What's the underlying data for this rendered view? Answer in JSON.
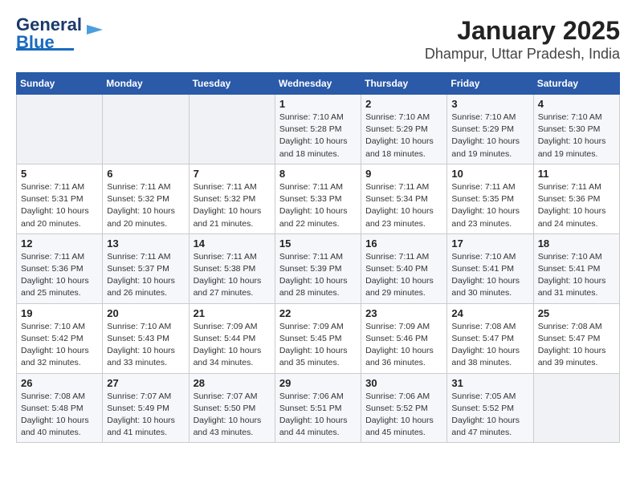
{
  "logo": {
    "line1": "General",
    "line2": "Blue"
  },
  "title": "January 2025",
  "subtitle": "Dhampur, Uttar Pradesh, India",
  "days_header": [
    "Sunday",
    "Monday",
    "Tuesday",
    "Wednesday",
    "Thursday",
    "Friday",
    "Saturday"
  ],
  "weeks": [
    [
      {
        "day": "",
        "info": ""
      },
      {
        "day": "",
        "info": ""
      },
      {
        "day": "",
        "info": ""
      },
      {
        "day": "1",
        "info": "Sunrise: 7:10 AM\nSunset: 5:28 PM\nDaylight: 10 hours\nand 18 minutes."
      },
      {
        "day": "2",
        "info": "Sunrise: 7:10 AM\nSunset: 5:29 PM\nDaylight: 10 hours\nand 18 minutes."
      },
      {
        "day": "3",
        "info": "Sunrise: 7:10 AM\nSunset: 5:29 PM\nDaylight: 10 hours\nand 19 minutes."
      },
      {
        "day": "4",
        "info": "Sunrise: 7:10 AM\nSunset: 5:30 PM\nDaylight: 10 hours\nand 19 minutes."
      }
    ],
    [
      {
        "day": "5",
        "info": "Sunrise: 7:11 AM\nSunset: 5:31 PM\nDaylight: 10 hours\nand 20 minutes."
      },
      {
        "day": "6",
        "info": "Sunrise: 7:11 AM\nSunset: 5:32 PM\nDaylight: 10 hours\nand 20 minutes."
      },
      {
        "day": "7",
        "info": "Sunrise: 7:11 AM\nSunset: 5:32 PM\nDaylight: 10 hours\nand 21 minutes."
      },
      {
        "day": "8",
        "info": "Sunrise: 7:11 AM\nSunset: 5:33 PM\nDaylight: 10 hours\nand 22 minutes."
      },
      {
        "day": "9",
        "info": "Sunrise: 7:11 AM\nSunset: 5:34 PM\nDaylight: 10 hours\nand 23 minutes."
      },
      {
        "day": "10",
        "info": "Sunrise: 7:11 AM\nSunset: 5:35 PM\nDaylight: 10 hours\nand 23 minutes."
      },
      {
        "day": "11",
        "info": "Sunrise: 7:11 AM\nSunset: 5:36 PM\nDaylight: 10 hours\nand 24 minutes."
      }
    ],
    [
      {
        "day": "12",
        "info": "Sunrise: 7:11 AM\nSunset: 5:36 PM\nDaylight: 10 hours\nand 25 minutes."
      },
      {
        "day": "13",
        "info": "Sunrise: 7:11 AM\nSunset: 5:37 PM\nDaylight: 10 hours\nand 26 minutes."
      },
      {
        "day": "14",
        "info": "Sunrise: 7:11 AM\nSunset: 5:38 PM\nDaylight: 10 hours\nand 27 minutes."
      },
      {
        "day": "15",
        "info": "Sunrise: 7:11 AM\nSunset: 5:39 PM\nDaylight: 10 hours\nand 28 minutes."
      },
      {
        "day": "16",
        "info": "Sunrise: 7:11 AM\nSunset: 5:40 PM\nDaylight: 10 hours\nand 29 minutes."
      },
      {
        "day": "17",
        "info": "Sunrise: 7:10 AM\nSunset: 5:41 PM\nDaylight: 10 hours\nand 30 minutes."
      },
      {
        "day": "18",
        "info": "Sunrise: 7:10 AM\nSunset: 5:41 PM\nDaylight: 10 hours\nand 31 minutes."
      }
    ],
    [
      {
        "day": "19",
        "info": "Sunrise: 7:10 AM\nSunset: 5:42 PM\nDaylight: 10 hours\nand 32 minutes."
      },
      {
        "day": "20",
        "info": "Sunrise: 7:10 AM\nSunset: 5:43 PM\nDaylight: 10 hours\nand 33 minutes."
      },
      {
        "day": "21",
        "info": "Sunrise: 7:09 AM\nSunset: 5:44 PM\nDaylight: 10 hours\nand 34 minutes."
      },
      {
        "day": "22",
        "info": "Sunrise: 7:09 AM\nSunset: 5:45 PM\nDaylight: 10 hours\nand 35 minutes."
      },
      {
        "day": "23",
        "info": "Sunrise: 7:09 AM\nSunset: 5:46 PM\nDaylight: 10 hours\nand 36 minutes."
      },
      {
        "day": "24",
        "info": "Sunrise: 7:08 AM\nSunset: 5:47 PM\nDaylight: 10 hours\nand 38 minutes."
      },
      {
        "day": "25",
        "info": "Sunrise: 7:08 AM\nSunset: 5:47 PM\nDaylight: 10 hours\nand 39 minutes."
      }
    ],
    [
      {
        "day": "26",
        "info": "Sunrise: 7:08 AM\nSunset: 5:48 PM\nDaylight: 10 hours\nand 40 minutes."
      },
      {
        "day": "27",
        "info": "Sunrise: 7:07 AM\nSunset: 5:49 PM\nDaylight: 10 hours\nand 41 minutes."
      },
      {
        "day": "28",
        "info": "Sunrise: 7:07 AM\nSunset: 5:50 PM\nDaylight: 10 hours\nand 43 minutes."
      },
      {
        "day": "29",
        "info": "Sunrise: 7:06 AM\nSunset: 5:51 PM\nDaylight: 10 hours\nand 44 minutes."
      },
      {
        "day": "30",
        "info": "Sunrise: 7:06 AM\nSunset: 5:52 PM\nDaylight: 10 hours\nand 45 minutes."
      },
      {
        "day": "31",
        "info": "Sunrise: 7:05 AM\nSunset: 5:52 PM\nDaylight: 10 hours\nand 47 minutes."
      },
      {
        "day": "",
        "info": ""
      }
    ]
  ]
}
